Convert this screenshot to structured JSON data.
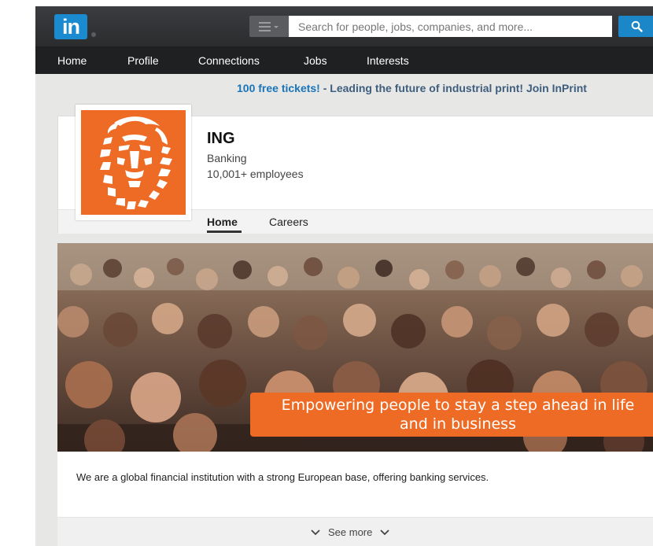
{
  "header": {
    "logo_text": "in",
    "search_placeholder": "Search for people, jobs, companies, and more..."
  },
  "nav": {
    "items": [
      "Home",
      "Profile",
      "Connections",
      "Jobs",
      "Interests"
    ]
  },
  "promo": {
    "highlight": "100 free tickets!",
    "text": " - Leading the future of industrial print! Join InPrint"
  },
  "company": {
    "name": "ING",
    "industry": "Banking",
    "size": "10,001+ employees",
    "brand_color": "#ee6b25",
    "tabs": [
      {
        "label": "Home",
        "active": true
      },
      {
        "label": "Careers",
        "active": false
      }
    ]
  },
  "hero": {
    "tagline_line1": "Empowering people to stay a step ahead in life",
    "tagline_line2": "and in business"
  },
  "about": {
    "description": "We are a global financial institution with a strong European base, offering banking services.",
    "see_more": "See more"
  }
}
